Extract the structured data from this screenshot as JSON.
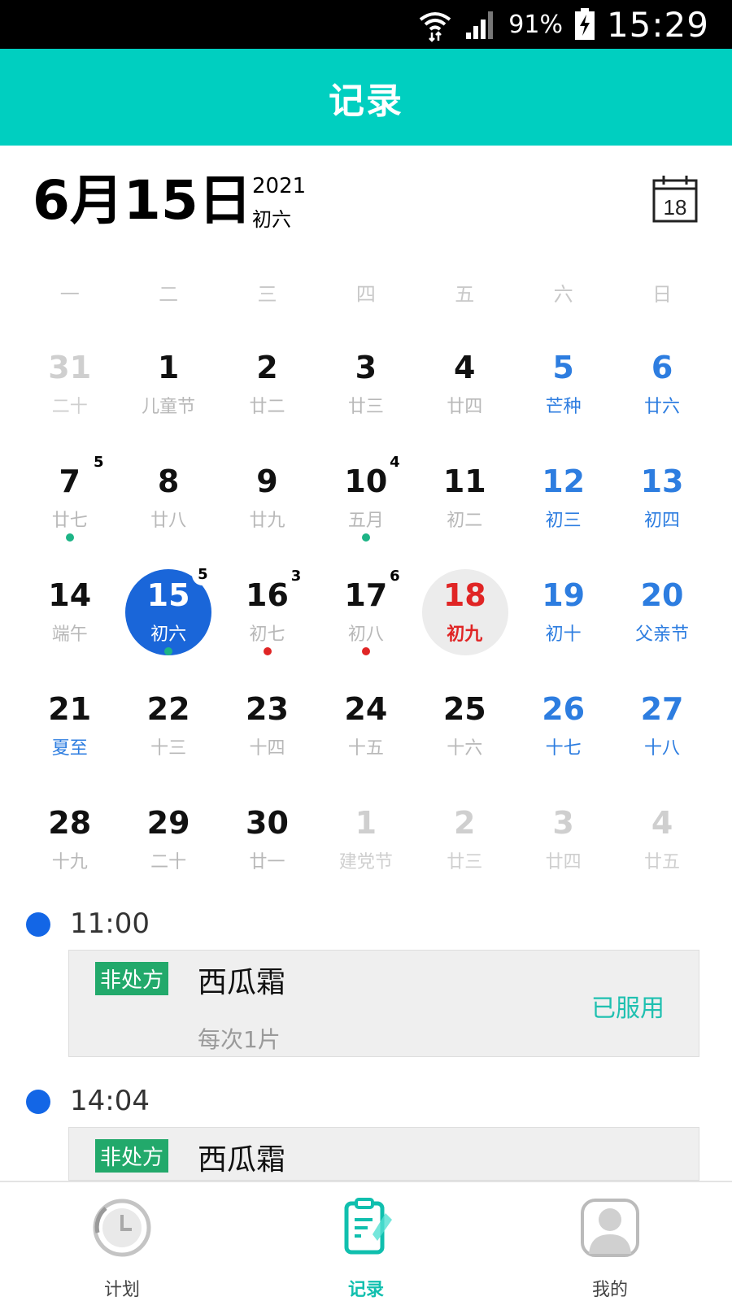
{
  "status_bar": {
    "battery": "91%",
    "time": "15:29"
  },
  "header": {
    "title": "记录"
  },
  "date": {
    "big": "6月15日",
    "year": "2021",
    "lunar": "初六",
    "today_icon_day": "18"
  },
  "weekdays": [
    "一",
    "二",
    "三",
    "四",
    "五",
    "六",
    "日"
  ],
  "colors": {
    "accent": "#00cfc0",
    "selected": "#1a66d9",
    "weekend": "#2d7de0",
    "today": "#e02525",
    "dot_green": "#1db486",
    "dot_red": "#e02525"
  },
  "calendar": [
    [
      {
        "n": "31",
        "l": "二十",
        "s": "dim"
      },
      {
        "n": "1",
        "l": "儿童节",
        "s": "normal"
      },
      {
        "n": "2",
        "l": "廿二",
        "s": "normal"
      },
      {
        "n": "3",
        "l": "廿三",
        "s": "normal"
      },
      {
        "n": "4",
        "l": "廿四",
        "s": "normal"
      },
      {
        "n": "5",
        "l": "芒种",
        "s": "weekend",
        "lb": "blue"
      },
      {
        "n": "6",
        "l": "廿六",
        "s": "weekend",
        "lb": "blue"
      }
    ],
    [
      {
        "n": "7",
        "l": "廿七",
        "s": "normal",
        "badge": "5",
        "dot": "green"
      },
      {
        "n": "8",
        "l": "廿八",
        "s": "normal"
      },
      {
        "n": "9",
        "l": "廿九",
        "s": "normal"
      },
      {
        "n": "10",
        "l": "五月",
        "s": "normal",
        "badge": "4",
        "dot": "green"
      },
      {
        "n": "11",
        "l": "初二",
        "s": "normal"
      },
      {
        "n": "12",
        "l": "初三",
        "s": "weekend",
        "lb": "blue"
      },
      {
        "n": "13",
        "l": "初四",
        "s": "weekend",
        "lb": "blue"
      }
    ],
    [
      {
        "n": "14",
        "l": "端午",
        "s": "normal"
      },
      {
        "n": "15",
        "l": "初六",
        "s": "selected",
        "badge": "5",
        "dot": "green"
      },
      {
        "n": "16",
        "l": "初七",
        "s": "normal",
        "badge": "3",
        "dot": "red"
      },
      {
        "n": "17",
        "l": "初八",
        "s": "normal",
        "badge": "6",
        "dot": "red"
      },
      {
        "n": "18",
        "l": "初九",
        "s": "today"
      },
      {
        "n": "19",
        "l": "初十",
        "s": "weekend",
        "lb": "blue"
      },
      {
        "n": "20",
        "l": "父亲节",
        "s": "weekend",
        "lb": "blue"
      }
    ],
    [
      {
        "n": "21",
        "l": "夏至",
        "s": "normal",
        "lb": "blue"
      },
      {
        "n": "22",
        "l": "十三",
        "s": "normal"
      },
      {
        "n": "23",
        "l": "十四",
        "s": "normal"
      },
      {
        "n": "24",
        "l": "十五",
        "s": "normal"
      },
      {
        "n": "25",
        "l": "十六",
        "s": "normal"
      },
      {
        "n": "26",
        "l": "十七",
        "s": "weekend",
        "lb": "blue"
      },
      {
        "n": "27",
        "l": "十八",
        "s": "weekend",
        "lb": "blue"
      }
    ],
    [
      {
        "n": "28",
        "l": "十九",
        "s": "normal"
      },
      {
        "n": "29",
        "l": "二十",
        "s": "normal"
      },
      {
        "n": "30",
        "l": "廿一",
        "s": "normal"
      },
      {
        "n": "1",
        "l": "建党节",
        "s": "dim"
      },
      {
        "n": "2",
        "l": "廿三",
        "s": "dim"
      },
      {
        "n": "3",
        "l": "廿四",
        "s": "dim"
      },
      {
        "n": "4",
        "l": "廿五",
        "s": "dim"
      }
    ]
  ],
  "records": [
    {
      "time": "11:00",
      "tag": "非处方",
      "name": "西瓜霜",
      "dose": "每次1片",
      "status": "已服用"
    },
    {
      "time": "14:04",
      "tag": "非处方",
      "name": "西瓜霜"
    }
  ],
  "nav": [
    {
      "label": "计划",
      "icon": "clock-icon"
    },
    {
      "label": "记录",
      "icon": "clipboard-icon"
    },
    {
      "label": "我的",
      "icon": "user-icon"
    }
  ]
}
